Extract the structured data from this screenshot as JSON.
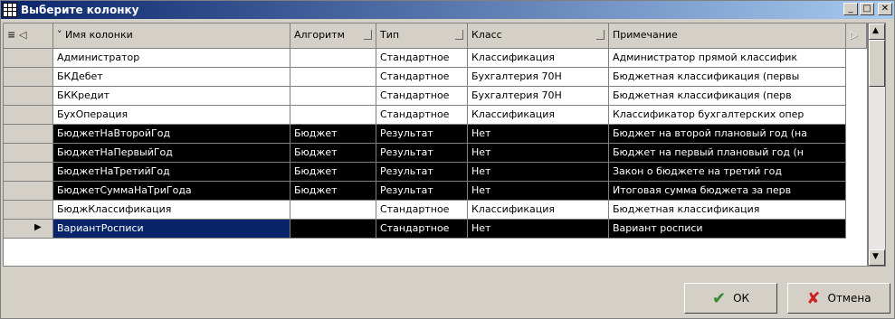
{
  "window": {
    "title": "Выберите колонку",
    "app_icon": "table-icon",
    "controls": [
      "minimize",
      "maximize",
      "close"
    ]
  },
  "grid": {
    "columns": [
      "Имя колонки",
      "Алгоритм",
      "Тип",
      "Класс",
      "Примечание"
    ],
    "rows": [
      {
        "name": "Администратор",
        "algorithm": "",
        "type": "Стандартное",
        "class": "Классификация",
        "note": "Администратор прямой классифик",
        "selected": false,
        "current": false
      },
      {
        "name": "БКДебет",
        "algorithm": "",
        "type": "Стандартное",
        "class": "Бухгалтерия 70Н",
        "note": "Бюджетная классификация (первы",
        "selected": false,
        "current": false
      },
      {
        "name": "БККредит",
        "algorithm": "",
        "type": "Стандартное",
        "class": "Бухгалтерия 70Н",
        "note": "Бюджетная классификация (перв",
        "selected": false,
        "current": false
      },
      {
        "name": "БухОперация",
        "algorithm": "",
        "type": "Стандартное",
        "class": "Классификация",
        "note": "Классификатор бухгалтерских опер",
        "selected": false,
        "current": false
      },
      {
        "name": "БюджетНаВторойГод",
        "algorithm": "Бюджет",
        "type": "Результат",
        "class": "Нет",
        "note": "Бюджет на второй плановый год (на",
        "selected": true,
        "current": false
      },
      {
        "name": "БюджетНаПервыйГод",
        "algorithm": "Бюджет",
        "type": "Результат",
        "class": "Нет",
        "note": "Бюджет на первый плановый год (н",
        "selected": true,
        "current": false
      },
      {
        "name": "БюджетНаТретийГод",
        "algorithm": "Бюджет",
        "type": "Результат",
        "class": "Нет",
        "note": "Закон о бюджете на третий год",
        "selected": true,
        "current": false
      },
      {
        "name": "БюджетСуммаНаТриГода",
        "algorithm": "Бюджет",
        "type": "Результат",
        "class": "Нет",
        "note": "Итоговая сумма бюджета за перв",
        "selected": true,
        "current": false
      },
      {
        "name": "БюджКлассификация",
        "algorithm": "",
        "type": "Стандартное",
        "class": "Классификация",
        "note": "Бюджетная классификация",
        "selected": false,
        "current": false
      },
      {
        "name": "ВариантРосписи",
        "algorithm": "",
        "type": "Стандартное",
        "class": "Нет",
        "note": "Вариант росписи",
        "selected": true,
        "current": true
      }
    ]
  },
  "buttons": {
    "ok": "ОК",
    "cancel": "Отмена"
  },
  "colors": {
    "title_start": "#0a246a",
    "title_end": "#a6caf0",
    "selected_bg": "#000000",
    "current_name_bg": "#0a246a",
    "ok_check": "#2e8b2e",
    "cancel_x": "#d02020"
  }
}
